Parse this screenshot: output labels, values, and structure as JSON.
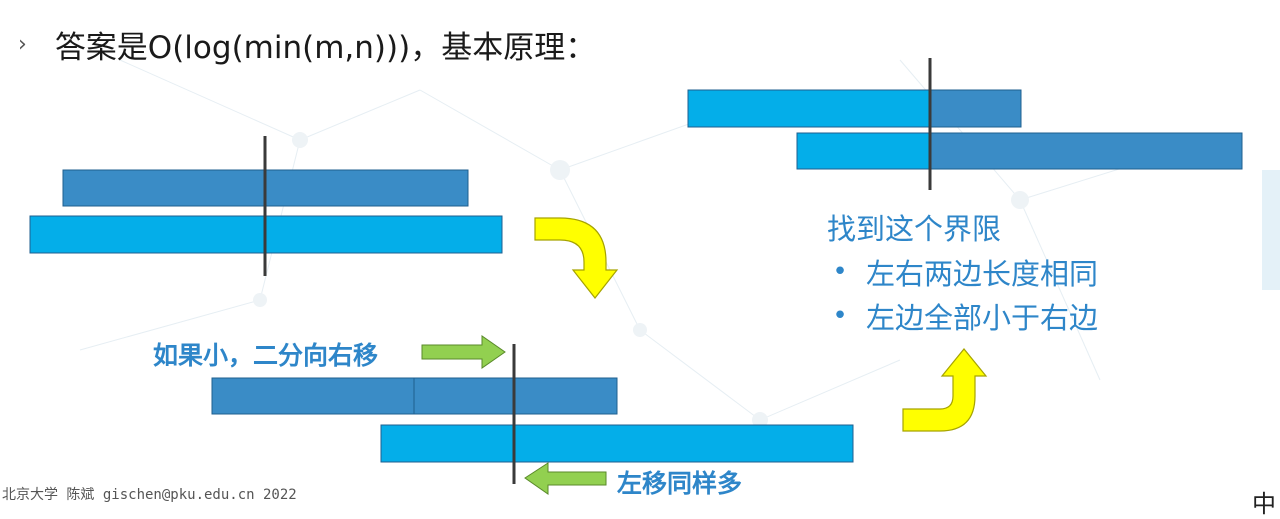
{
  "heading": {
    "bullet": "›",
    "text": "答案是O(log(min(m,n)))，基本原理："
  },
  "right_panel": {
    "title": "找到这个界限",
    "items": [
      "左右两边长度相同",
      "左边全部小于右边"
    ]
  },
  "labels": {
    "shift_right": "如果小，二分向右移",
    "shift_left": "左移同样多"
  },
  "footer": "北京大学 陈斌 gischen@pku.edu.cn 2022",
  "logo": "中",
  "colors": {
    "dark_bar": "#3a8cc6",
    "light_bar": "#04aee9",
    "yellow_arrow": "#ffff00",
    "green_arrow": "#92d050",
    "accent_text": "#2e86c9"
  }
}
